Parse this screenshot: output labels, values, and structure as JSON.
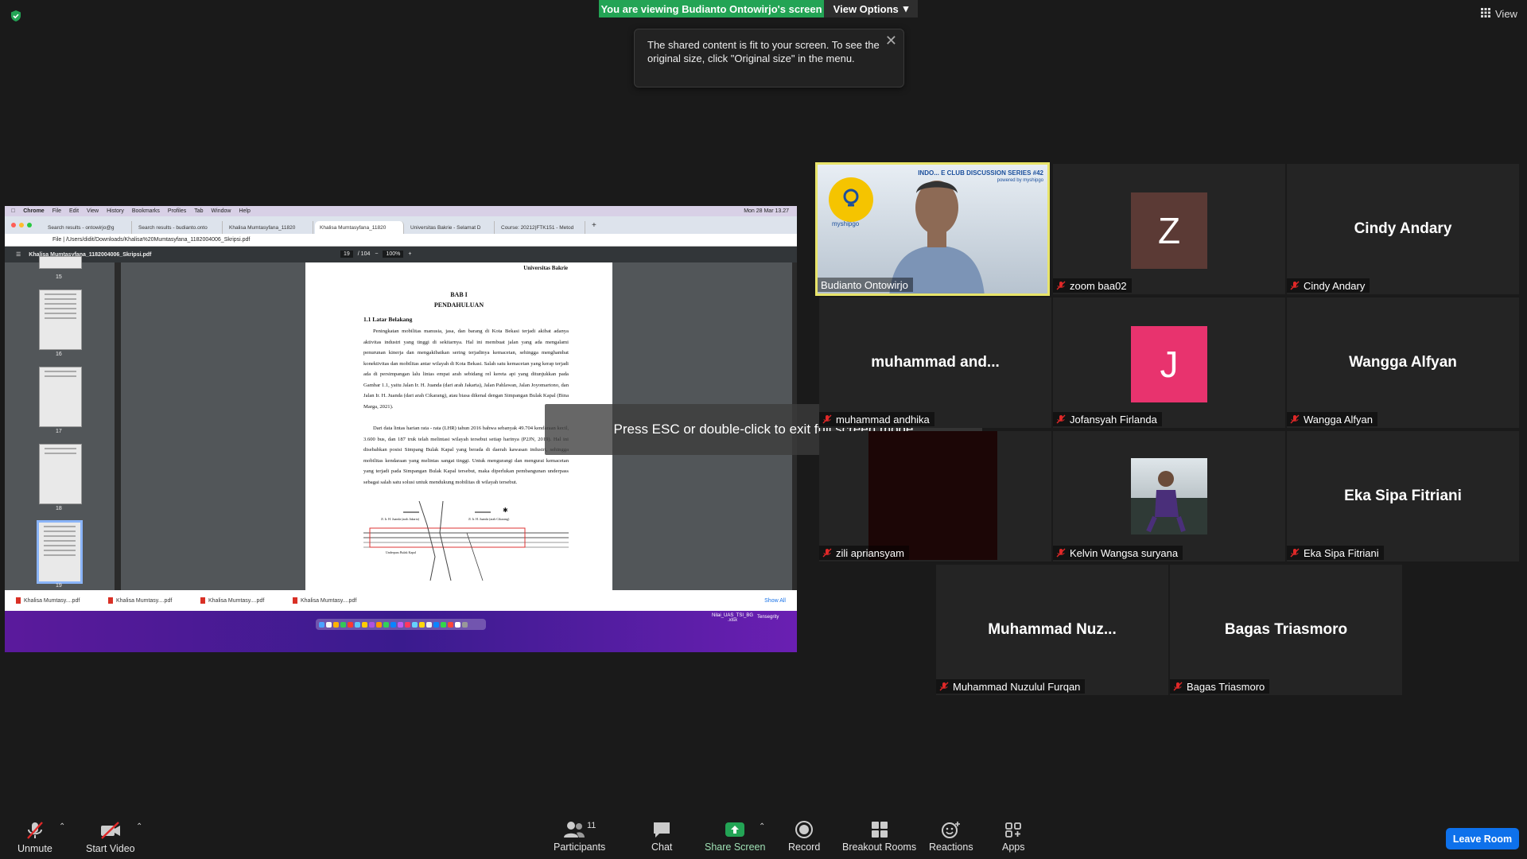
{
  "banner": {
    "text": "You are viewing Budianto Ontowirjo's screen",
    "view_options": "View Options"
  },
  "top_right": {
    "view_label": "View"
  },
  "tooltip": {
    "text": "The shared content is fit to your screen. To see the original size, click \"Original size\" in the menu."
  },
  "esc_overlay": "Press ESC or double-click to exit full screen mode",
  "shared": {
    "menubar": [
      "Chrome",
      "File",
      "Edit",
      "View",
      "History",
      "Bookmarks",
      "Profiles",
      "Tab",
      "Window",
      "Help"
    ],
    "clock": "Mon 28 Mar  13.27",
    "tabs": [
      "Search results - ontowirjo@g",
      "Search results - budianto.onto",
      "Khalisa Mumtasyfana_11820",
      "Khalisa Mumtasyfana_11820",
      "Universitas Bakrie - Selamat D",
      "Course: 20212|FTK151 - Metod"
    ],
    "url": "File  |  /Users/didit/Downloads/Khalisa%20Mumtasyfana_1182004006_Skripsi.pdf",
    "pdf_title": "Khalisa Mumtasyfana_1182004006_Skripsi.pdf",
    "page_current": "19",
    "page_total": "/ 104",
    "zoom": "100%",
    "thumb_numbers": [
      "15",
      "16",
      "17",
      "18",
      "19"
    ],
    "page": {
      "header": "Universitas Bakrie",
      "bab": "BAB I",
      "bab_title": "PENDAHULUAN",
      "section": "1.1  Latar Belakang",
      "para1": "Peningkatan mobilitas manusia, jasa, dan barang di Kota Bekasi terjadi akibat adanya aktivitas industri yang tinggi di sekitarnya. Hal ini membuat jalan yang ada mengalami penurunan kinerja dan mengakibatkan sering terjadinya kemacetan, sehingga menghambat konektivitas dan mobilitas antar wilayah di Kota Bekasi. Salah satu kemacetan yang kerap terjadi ada di persimpangan lalu lintas empat arah sebidang rel kereta api yang ditunjukkan pada Gambar 1.1, yaitu Jalan Ir. H. Juanda (dari arah Jakarta), Jalan Pahlawan, Jalan Joyomartono, dan Jalan Ir. H. Juanda (dari arah Cikarang), atau biasa dikenal dengan Simpangan Bulak Kapal (Bina Marga, 2021).",
      "para2": "Dari data lintas harian rata - rata (LHR) tahun 2016 bahwa sebanyak 49.704 kendaraan kecil, 3.600 bus, dan 187 truk telah melintasi wilayah tersebut setiap harinya (P2JN, 2019). Hal ini disebabkan posisi Simpang Bulak Kapal yang berada di daerah kawasan industri, sehingga mobilitas kendaraan yang melintas sangat tinggi. Untuk mengurangi dan mengurai kemacetan yang terjadi pada Simpangan Bulak Kapal tersebut, maka diperlukan pembangunan underpass sebagai salah satu solusi untuk mendukung mobilitas di wilayah tersebut.",
      "fig_label_left": "Jl. Ir. H. Juanda (arah Jakarta)",
      "fig_label_right": "Jl. Ir. H. Juanda (arah Cikarang)",
      "fig_label_bottom": "Underpass Bulak Kapal"
    },
    "downloads": [
      "Khalisa Mumtasy....pdf",
      "Khalisa Mumtasy....pdf",
      "Khalisa Mumtasy....pdf",
      "Khalisa Mumtasy....pdf"
    ],
    "show_all": "Show All",
    "desk_file": "Nilai_UAS_TSI_BG\n.xlsx",
    "desk_tenseg": "Tensegrity"
  },
  "participants_tiles": [
    {
      "name": "Budianto Ontowirjo",
      "type": "video",
      "speaker": true,
      "banner": "INDO... E CLUB DISCUSSION SERIES #42",
      "powered": "powered by myshipgo",
      "logo": "myshipgo"
    },
    {
      "name": "zoom baa02",
      "type": "avatar",
      "initial": "Z",
      "color": "#5b3a35",
      "muted": true
    },
    {
      "name": "Cindy Andary",
      "type": "name",
      "big": "Cindy Andary",
      "muted": true
    },
    {
      "name": "muhammad andhika",
      "type": "name",
      "big": "muhammad  and...",
      "muted": true
    },
    {
      "name": "Jofansyah Firlanda",
      "type": "avatar",
      "initial": "J",
      "color": "#e8336e",
      "muted": true
    },
    {
      "name": "Wangga Alfyan",
      "type": "name",
      "big": "Wangga Alfyan",
      "muted": true
    },
    {
      "name": "zili apriansyam",
      "type": "dark",
      "muted": true
    },
    {
      "name": "Kelvin Wangsa suryana",
      "type": "photo",
      "muted": true
    },
    {
      "name": "Eka Sipa Fitriani",
      "type": "name",
      "big": "Eka Sipa Fitriani",
      "muted": true
    },
    {
      "name": "Muhammad Nuzulul Furqan",
      "type": "name",
      "big": "Muhammad  Nuz...",
      "muted": true
    },
    {
      "name": "Bagas Triasmoro",
      "type": "name",
      "big": "Bagas Triasmoro",
      "muted": true
    }
  ],
  "toolbar": {
    "unmute": "Unmute",
    "start_video": "Start Video",
    "participants": "Participants",
    "participants_count": "11",
    "chat": "Chat",
    "share_screen": "Share Screen",
    "record": "Record",
    "breakout": "Breakout Rooms",
    "reactions": "Reactions",
    "apps": "Apps",
    "leave": "Leave Room"
  },
  "colors": {
    "share_green": "#23a455",
    "leave_blue": "#0e71eb",
    "speaker_border": "#e8e46a",
    "muted_red": "#e02828"
  }
}
